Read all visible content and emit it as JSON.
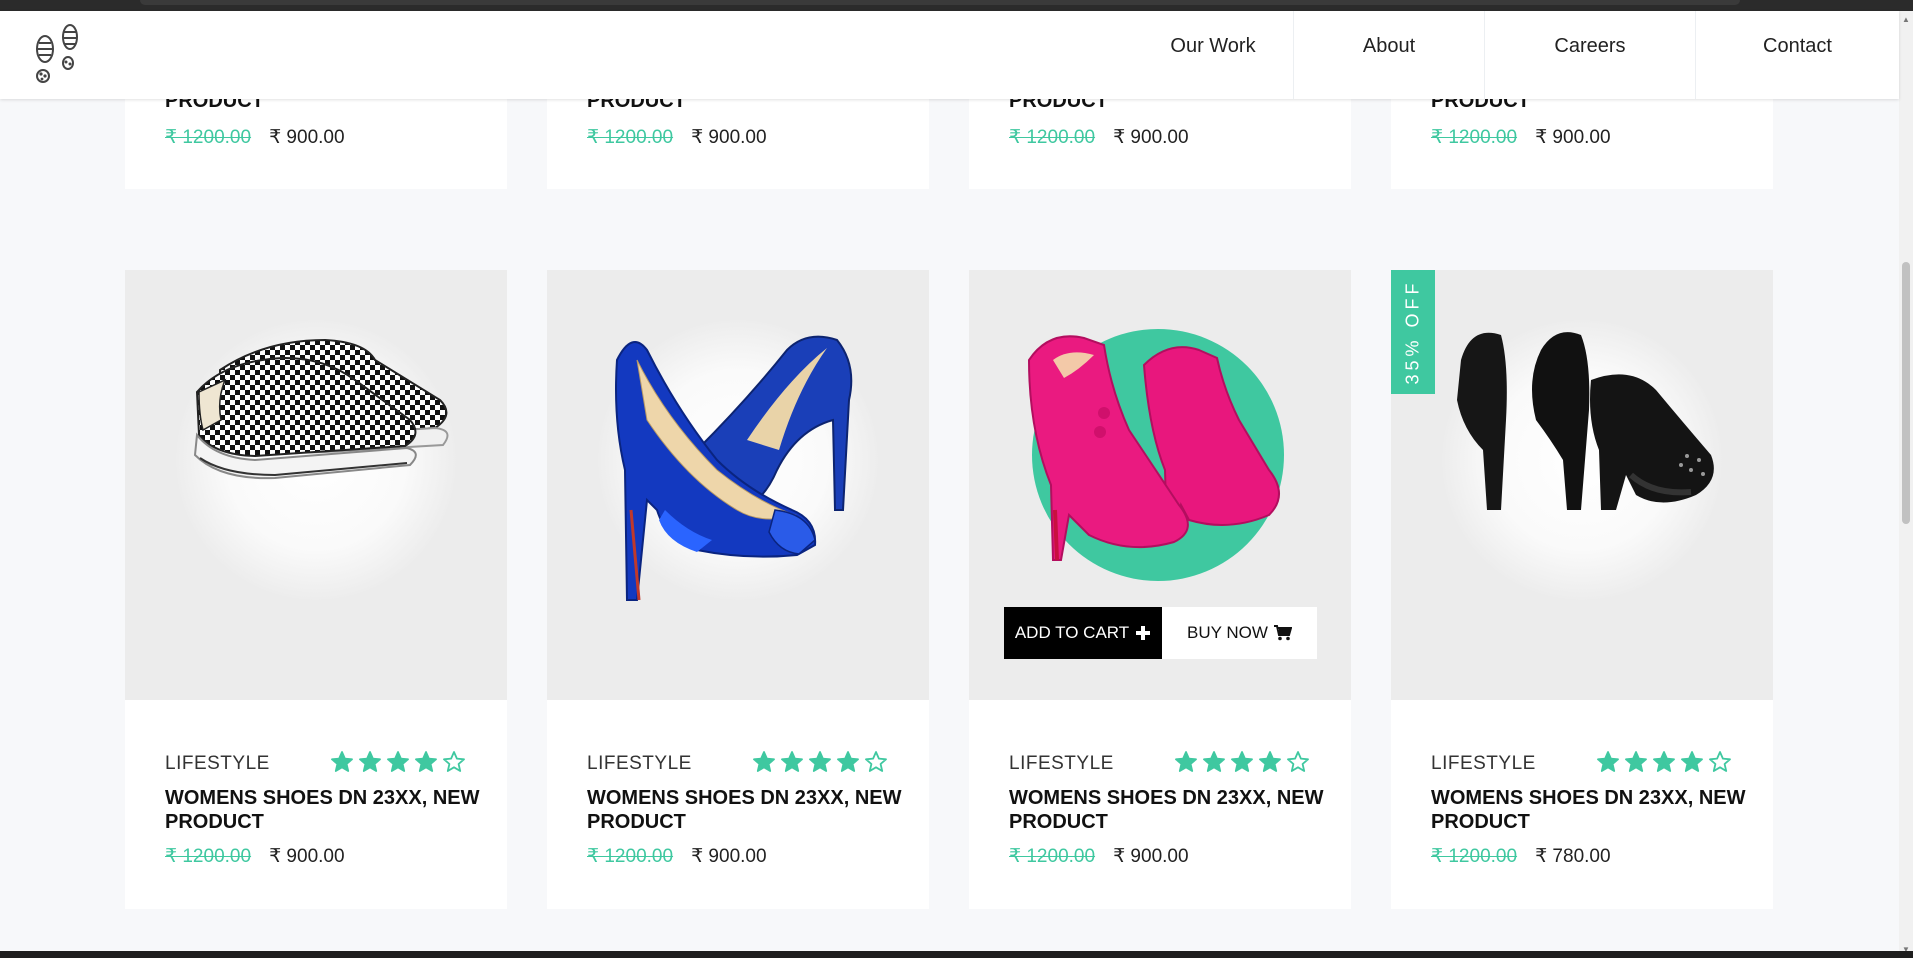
{
  "nav": {
    "items": [
      {
        "label": "Our Work"
      },
      {
        "label": "About"
      },
      {
        "label": "Careers"
      },
      {
        "label": "Contact"
      }
    ]
  },
  "top_row": [
    {
      "title": "PRODUCT",
      "old_price": "₹ 1200.00",
      "new_price": "₹ 900.00"
    },
    {
      "title": "PRODUCT",
      "old_price": "₹ 1200.00",
      "new_price": "₹ 900.00"
    },
    {
      "title": "PRODUCT",
      "old_price": "₹ 1200.00",
      "new_price": "₹ 900.00"
    },
    {
      "title": "PRODUCT",
      "old_price": "₹ 1200.00",
      "new_price": "₹ 900.00"
    }
  ],
  "products": [
    {
      "category": "LIFESTYLE",
      "name": "WOMENS SHOES DN 23XX, NEW PRODUCT",
      "old_price": "₹ 1200.00",
      "new_price": "₹ 900.00",
      "rating": 4,
      "rating_max": 5,
      "image_icon": "checkered-slip-on-sneaker"
    },
    {
      "category": "LIFESTYLE",
      "name": "WOMENS SHOES DN 23XX, NEW PRODUCT",
      "old_price": "₹ 1200.00",
      "new_price": "₹ 900.00",
      "rating": 4,
      "rating_max": 5,
      "image_icon": "blue-high-heel-pumps"
    },
    {
      "category": "LIFESTYLE",
      "name": "WOMENS SHOES DN 23XX, NEW PRODUCT",
      "old_price": "₹ 1200.00",
      "new_price": "₹ 900.00",
      "rating": 4,
      "rating_max": 5,
      "image_icon": "pink-ankle-boot-heels"
    },
    {
      "category": "LIFESTYLE",
      "name": "WOMENS SHOES DN 23XX, NEW PRODUCT",
      "old_price": "₹ 1200.00",
      "new_price": "₹ 780.00",
      "rating": 4,
      "rating_max": 5,
      "image_icon": "black-platform-heels"
    }
  ],
  "hover_actions": {
    "add_to_cart_label": "ADD TO CART",
    "buy_now_label": "BUY NOW"
  },
  "badge": {
    "text": "35% OFF"
  },
  "colors": {
    "accent": "#3fc8a0",
    "button_dark": "#000000",
    "image_bg": "#ececec",
    "page_bg": "#f7f8fa"
  }
}
